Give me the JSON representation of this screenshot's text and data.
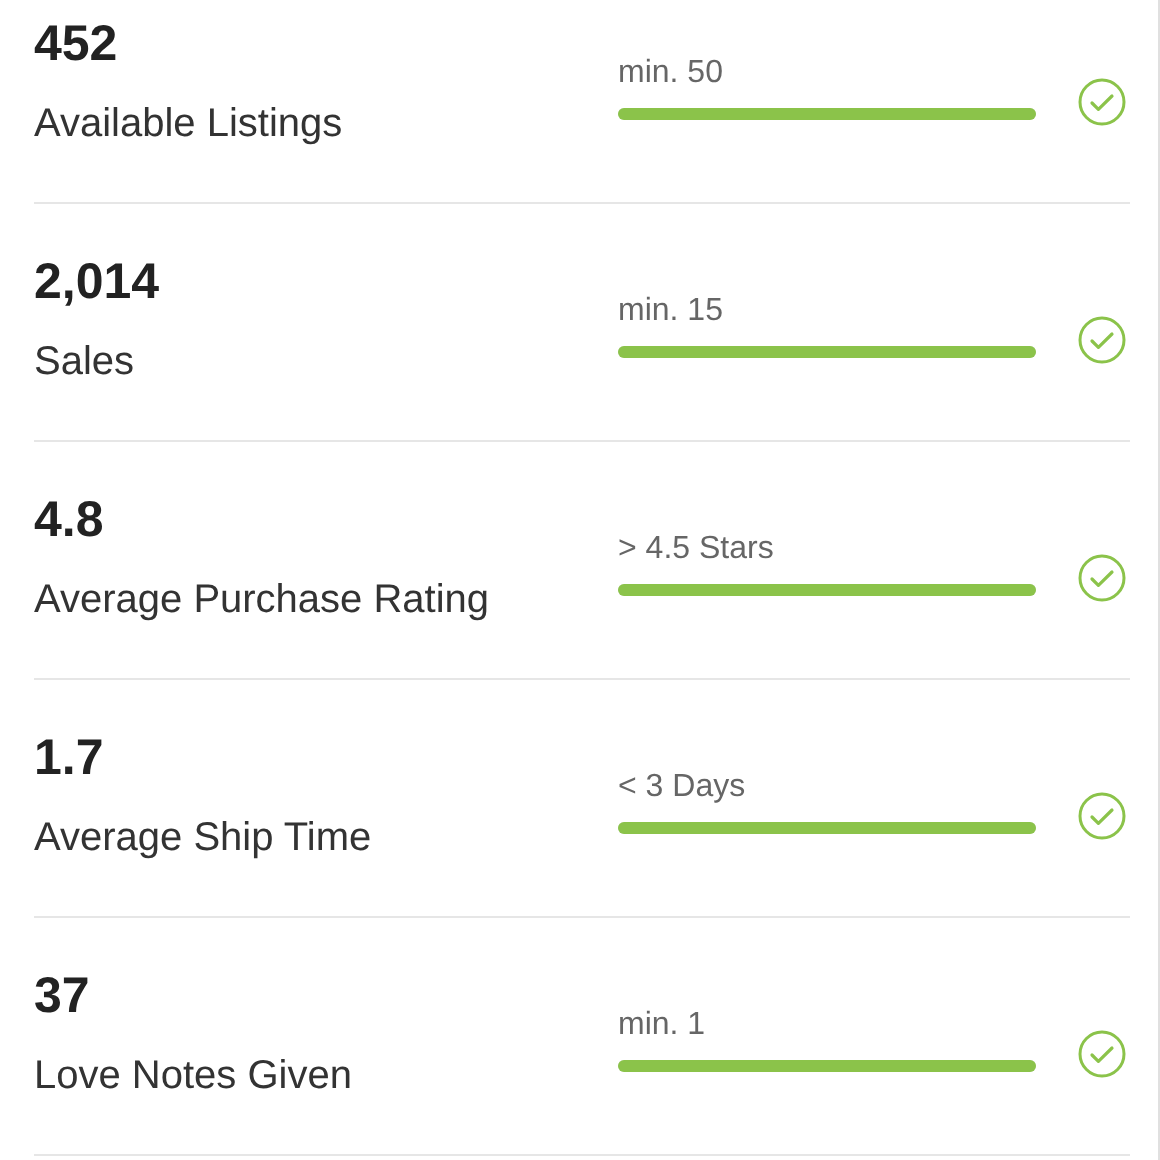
{
  "metrics": [
    {
      "value": "452",
      "label": "Available Listings",
      "requirement": "min. 50",
      "level": 1,
      "met": true
    },
    {
      "value": "2,014",
      "label": "Sales",
      "requirement": "min. 15",
      "level": 1,
      "met": true
    },
    {
      "value": "4.8",
      "label": "Average Purchase Rating",
      "requirement": "> 4.5 Stars",
      "level": 1,
      "met": true
    },
    {
      "value": "1.7",
      "label": "Average Ship Time",
      "requirement": "< 3 Days",
      "level": 1,
      "met": true
    },
    {
      "value": "37",
      "label": "Love Notes Given",
      "requirement": "min. 1",
      "level": 1,
      "met": true
    }
  ]
}
